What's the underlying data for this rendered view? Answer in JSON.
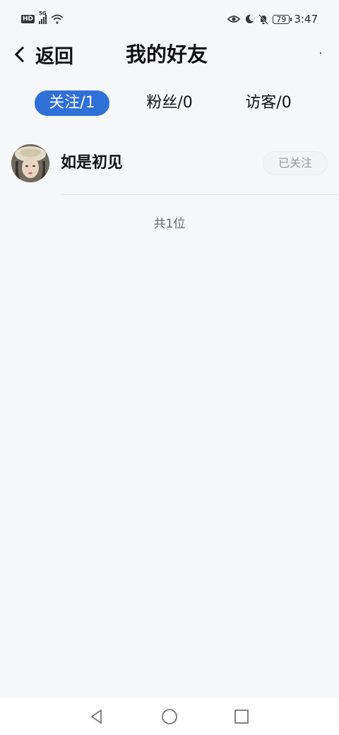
{
  "status_bar": {
    "network_badge": "HD",
    "network_type": "5G",
    "battery": "79",
    "time": "3:47"
  },
  "header": {
    "back_label": "返回",
    "title": "我的好友"
  },
  "tabs": [
    {
      "label": "关注/1",
      "active": true
    },
    {
      "label": "粉丝/0",
      "active": false
    },
    {
      "label": "访客/0",
      "active": false
    }
  ],
  "list": {
    "items": [
      {
        "name": "如是初见",
        "action_label": "已关注"
      }
    ],
    "total": "共1位"
  },
  "colors": {
    "accent": "#2f6fd8",
    "background": "#f6f7f9"
  },
  "icons": {
    "status": [
      "eye-icon",
      "moon-icon",
      "bell-off-icon",
      "wifi-icon",
      "signal-icon"
    ],
    "nav": [
      "nav-back-icon",
      "nav-home-icon",
      "nav-recent-icon"
    ]
  }
}
